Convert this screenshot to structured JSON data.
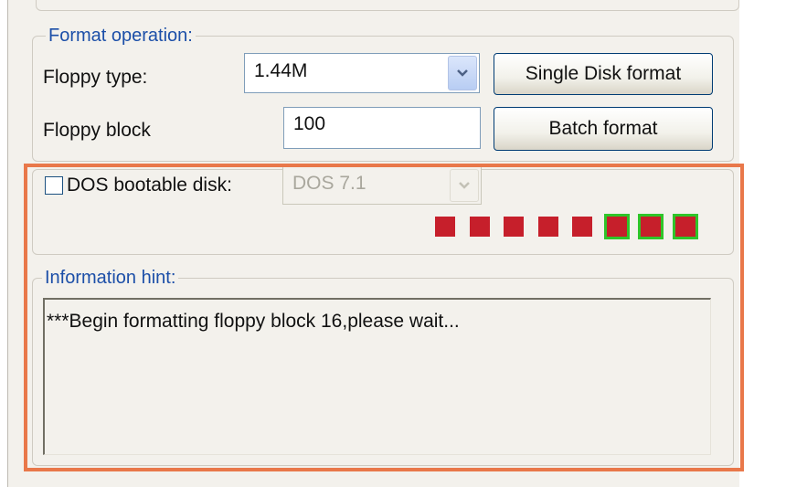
{
  "format_operation": {
    "legend": "Format operation:",
    "floppy_type_label": "Floppy type:",
    "floppy_type_value": "1.44M",
    "floppy_block_label": "Floppy block",
    "floppy_block_value": "100",
    "single_disk_format_button": "Single Disk format",
    "batch_format_button": "Batch format"
  },
  "dos_options": {
    "bootable_label": "DOS bootable disk:",
    "bootable_checked": false,
    "dos_version_value": "DOS 7.1"
  },
  "progress_indicator": {
    "total_blocks": 8,
    "highlighted_blocks": [
      5,
      6,
      7
    ],
    "block_color": "#c61f2b",
    "highlight_color": "#2fc52a"
  },
  "information": {
    "legend": "Information hint:",
    "message": "***Begin formatting floppy block 16,please wait..."
  },
  "colors": {
    "legend_text": "#1c4fa8",
    "annotation_border": "#e9784a"
  }
}
